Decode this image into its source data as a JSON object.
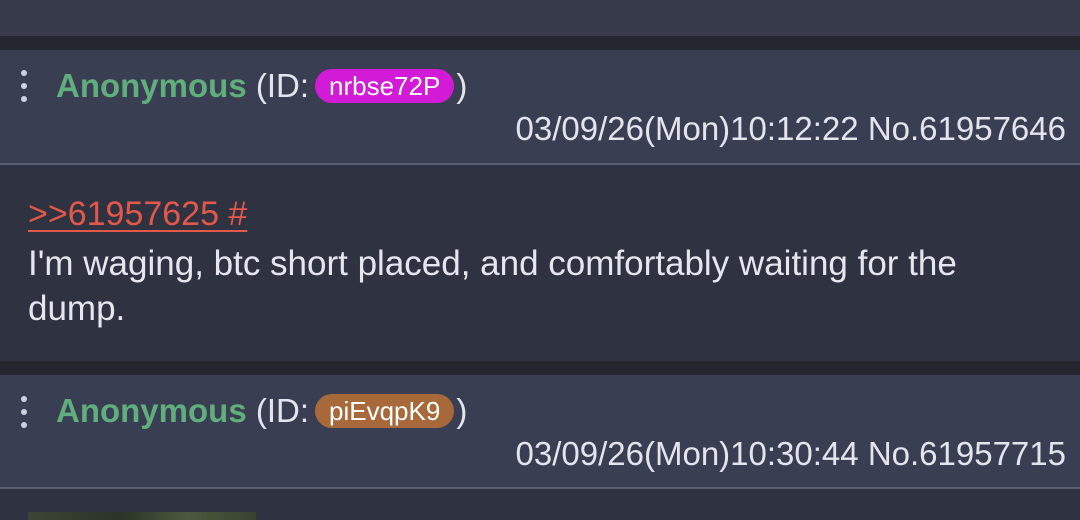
{
  "posts": [
    {
      "name": "Anonymous",
      "id_prefix": "(ID: ",
      "id": "nrbse72P",
      "id_suffix": ")",
      "id_color": "#d21bd6",
      "datetime": "03/09/26(Mon)10:12:22",
      "number": "No.61957646",
      "quote": ">>61957625 #",
      "comment": "I'm waging, btc short placed, and comfortably waiting for the dump."
    },
    {
      "name": "Anonymous",
      "id_prefix": "(ID: ",
      "id": "piEvqpK9",
      "id_suffix": ")",
      "id_color": "#a8693a",
      "datetime": "03/09/26(Mon)10:30:44",
      "number": "No.61957715"
    }
  ]
}
